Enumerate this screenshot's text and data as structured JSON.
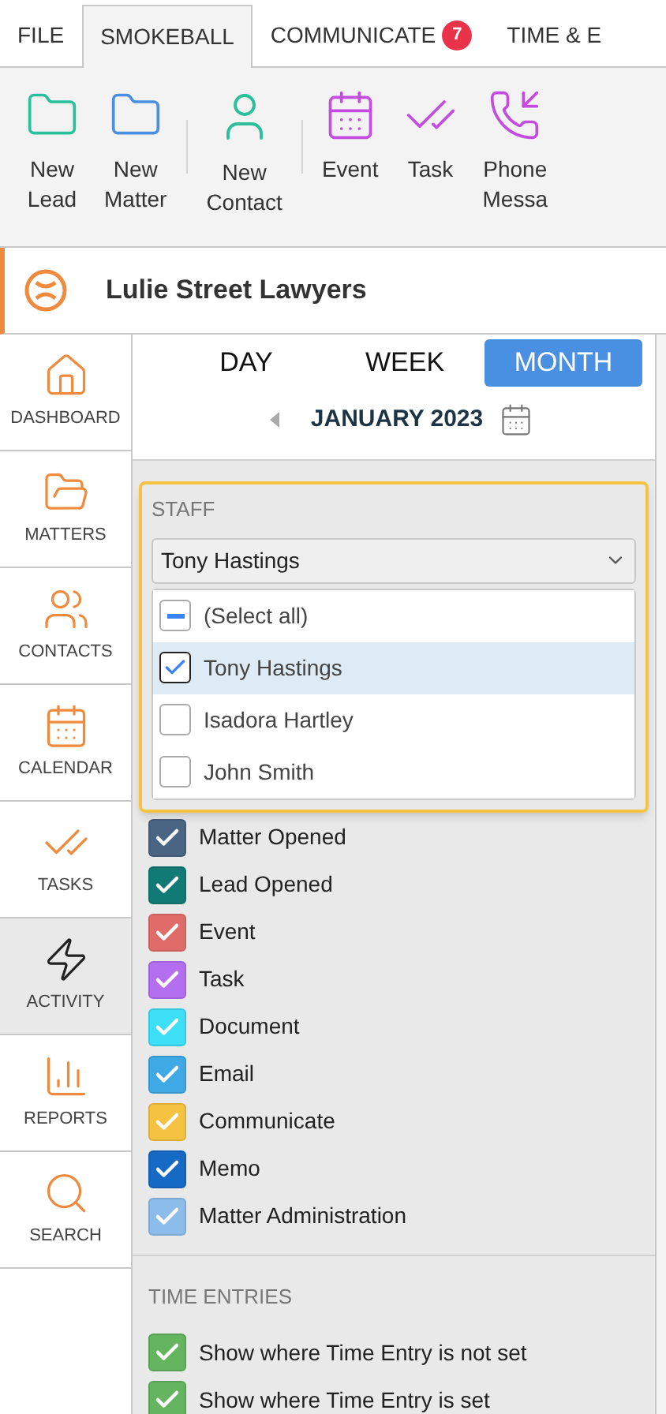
{
  "menu_tabs": [
    {
      "label": "FILE",
      "selected": false
    },
    {
      "label": "SMOKEBALL",
      "selected": true
    },
    {
      "label": "COMMUNICATE",
      "selected": false,
      "badge": "7"
    },
    {
      "label": "TIME & E",
      "selected": false
    }
  ],
  "ribbon_groups": [
    [
      {
        "kind": "lead",
        "label": "New\nLead"
      },
      {
        "kind": "matter",
        "label": "New\nMatter"
      }
    ],
    [
      {
        "kind": "contact",
        "label": "New\nContact"
      }
    ],
    [
      {
        "kind": "event",
        "label": "Event"
      },
      {
        "kind": "task",
        "label": "Task"
      },
      {
        "kind": "phone",
        "label": "Phone\nMessa"
      }
    ]
  ],
  "firm": {
    "name": "Lulie Street Lawyers"
  },
  "sidebar": {
    "items": [
      {
        "kind": "dashboard",
        "label": "DASHBOARD",
        "selected": false
      },
      {
        "kind": "matters",
        "label": "MATTERS",
        "selected": false
      },
      {
        "kind": "contacts",
        "label": "CONTACTS",
        "selected": false
      },
      {
        "kind": "calendar",
        "label": "CALENDAR",
        "selected": false
      },
      {
        "kind": "tasks",
        "label": "TASKS",
        "selected": false
      },
      {
        "kind": "activity",
        "label": "ACTIVITY",
        "selected": true
      },
      {
        "kind": "reports",
        "label": "REPORTS",
        "selected": false
      },
      {
        "kind": "search",
        "label": "SEARCH",
        "selected": false
      }
    ]
  },
  "view_tabs": [
    {
      "label": "DAY",
      "selected": false
    },
    {
      "label": "WEEK",
      "selected": false
    },
    {
      "label": "MONTH",
      "selected": true
    }
  ],
  "period": {
    "label": "JANUARY 2023"
  },
  "staff": {
    "heading": "STAFF",
    "value": "Tony Hastings",
    "options": [
      {
        "label": "(Select all)",
        "indeterminate": true,
        "selected": false
      },
      {
        "label": "Tony Hastings",
        "checked": true,
        "selected": true
      },
      {
        "label": "Isadora Hartley",
        "checked": false,
        "selected": false
      },
      {
        "label": "John Smith",
        "checked": false,
        "selected": false
      }
    ]
  },
  "activity_types": [
    {
      "label": "Matter Opened",
      "checked": true,
      "color": "#4a6584"
    },
    {
      "label": "Lead Opened",
      "checked": true,
      "color": "#127a74"
    },
    {
      "label": "Event",
      "checked": true,
      "color": "#e06c6a"
    },
    {
      "label": "Task",
      "checked": true,
      "color": "#b46ff0"
    },
    {
      "label": "Document",
      "checked": true,
      "color": "#3ddff7"
    },
    {
      "label": "Email",
      "checked": true,
      "color": "#3fa9e6"
    },
    {
      "label": "Communicate",
      "checked": true,
      "color": "#f5c242"
    },
    {
      "label": "Memo",
      "checked": true,
      "color": "#1669c4"
    },
    {
      "label": "Matter Administration",
      "checked": true,
      "color": "#8bbcea"
    }
  ],
  "time_entries": {
    "heading": "TIME ENTRIES",
    "items": [
      {
        "label": "Show where Time Entry is not set",
        "checked": true,
        "color": "#64b460"
      },
      {
        "label": "Show where Time Entry is set",
        "checked": true,
        "color": "#64b460"
      }
    ]
  }
}
